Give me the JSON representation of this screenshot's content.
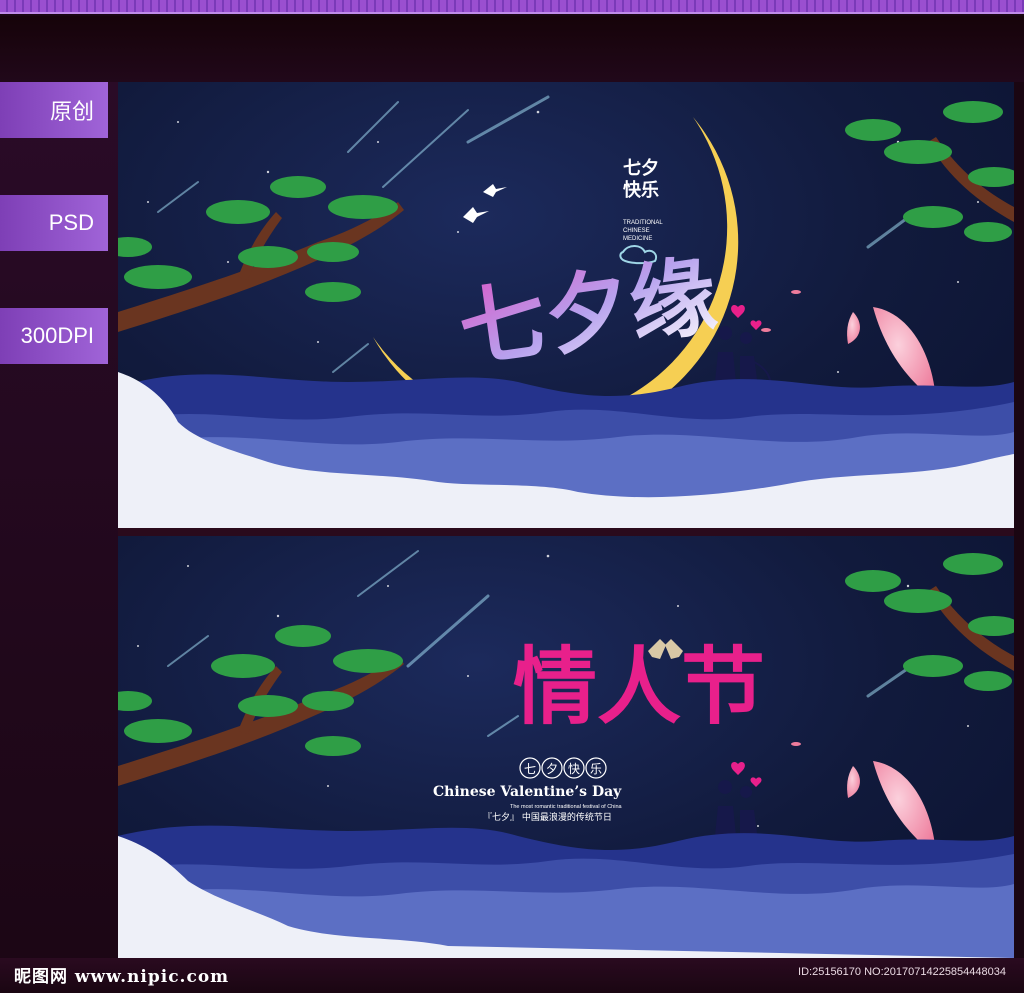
{
  "tags": [
    "原创",
    "PSD",
    "300DPI"
  ],
  "banner1": {
    "title": "七夕缘",
    "small_title_line1": "七夕",
    "small_title_line2": "快乐",
    "english_line1": "TRADITIONAL",
    "english_line2": "CHINESE",
    "english_line3": "MEDICINE"
  },
  "banner2": {
    "title": "情人节",
    "badge": [
      "七",
      "夕",
      "快",
      "乐"
    ],
    "english": "Chinese Valentine’s Day",
    "tagline_small": "The most romantic traditional festival of China",
    "tagline_cn": "『七夕』 中国最浪漫的传统节日"
  },
  "footer": {
    "logo": "昵图网 www.nipic.com",
    "photo_id": "ID:25156170 NO:20170714225854448034"
  },
  "colors": {
    "moon": "#f6cf53",
    "sky": "#111a3c",
    "pine": "#2f9e46",
    "wave_dark": "#25338c",
    "wave_light": "#5c6fc4",
    "cloud": "#eef0f8",
    "title_pink": "#e8208b",
    "tag_purple": "#8b4cc4"
  }
}
